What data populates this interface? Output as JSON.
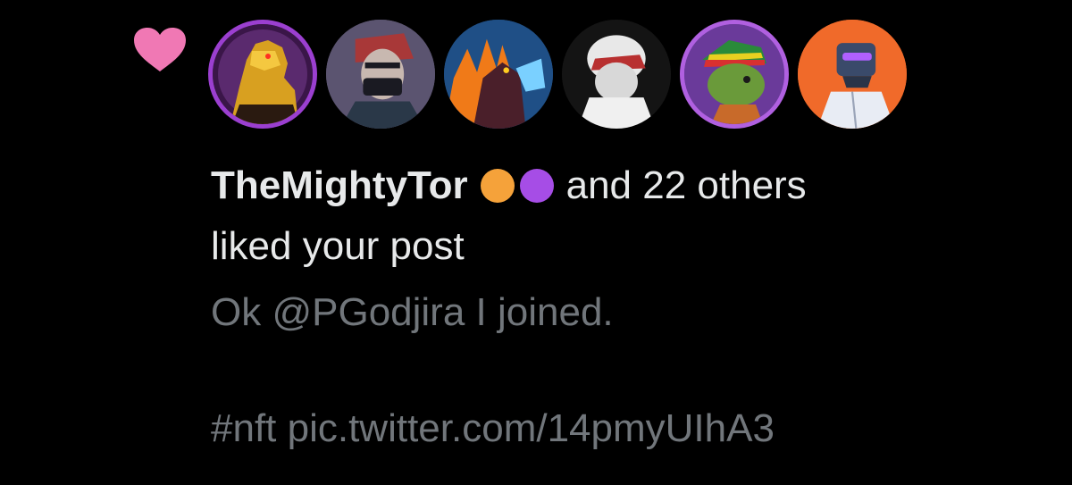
{
  "notification": {
    "type_icon": "heart-icon",
    "heart_color": "#f078b4",
    "avatars": [
      {
        "name": "avatar-gold-godzilla",
        "bg": "#5a2a6e",
        "ring": "#9b3fd0"
      },
      {
        "name": "avatar-masked-man",
        "bg": "#5b5470",
        "ring": "#3a3448"
      },
      {
        "name": "avatar-kaiju-fire",
        "bg": "#1f4f86",
        "ring": "#2a2a2a"
      },
      {
        "name": "avatar-white-hood",
        "bg": "#1a1a1a",
        "ring": "#222222"
      },
      {
        "name": "avatar-green-frog",
        "bg": "#6a3a9a",
        "ring": "#b060e0"
      },
      {
        "name": "avatar-robot-orange",
        "bg": "#f06a2a",
        "ring": "#f06a2a"
      }
    ],
    "user_name": "TheMightyTor",
    "emoji_dots": [
      {
        "name": "orange-circle-emoji",
        "color": "#f5a23a"
      },
      {
        "name": "purple-circle-emoji",
        "color": "#a64de6"
      }
    ],
    "others_text": "and 22 others",
    "action_text": "liked your post",
    "post_line1": "Ok @PGodjira I joined.",
    "post_line2": "#nft pic.twitter.com/14pmyUIhA3"
  }
}
